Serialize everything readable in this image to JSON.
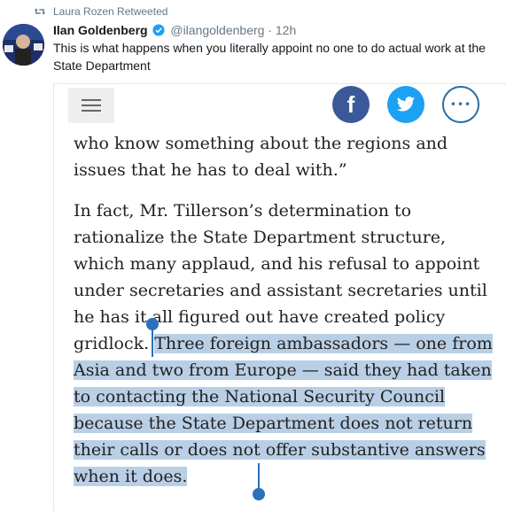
{
  "retweet": {
    "text": "Laura Rozen Retweeted",
    "icon": "retweet-icon"
  },
  "author": {
    "name": "Ilan Goldenberg",
    "handle": "@ilangoldenberg",
    "separator": "·",
    "time": "12h",
    "verified_icon": "verified-badge-icon"
  },
  "tweet": {
    "text": "This is what happens when you literally appoint no one to do actual work at the State Department"
  },
  "media": {
    "toolbar": {
      "menu_icon": "hamburger-menu-icon",
      "facebook_label": "f",
      "more_label": "•••"
    },
    "article": {
      "paragraph1": "who know something about the regions and issues that he has to deal with.”",
      "paragraph2_before": "In fact, Mr. Tillerson’s determination to rationalize the State Department structure, which many applaud, and his refusal to appoint under secretaries and assistant secretaries until he has it all figured out have created policy gridlock. ",
      "paragraph2_highlight": "Three foreign ambassadors — one from Asia and two from Europe — said they had taken to contacting the National Security Council because the State Department does not return their calls or does not offer substantive answers when it does."
    }
  },
  "colors": {
    "accent_blue": "#1da1f2",
    "facebook_blue": "#3b5998",
    "selection_highlight": "#b9cfe6",
    "selection_handle": "#2c6fbb"
  }
}
